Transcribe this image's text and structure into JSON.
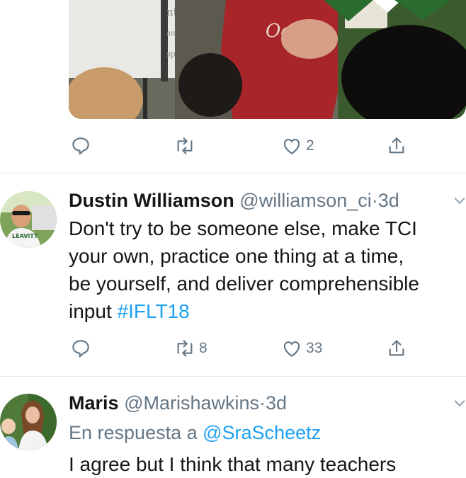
{
  "tweet1": {
    "media_alt_words": [
      "ntes",
      "ante/escritas",
      "spués"
    ],
    "actions": {
      "reply_count": "",
      "retweet_count": "",
      "like_count": "2"
    }
  },
  "tweet2": {
    "name": "Dustin Williamson",
    "handle": "@williamson_ci",
    "dot": "·",
    "time": "3d",
    "lines": [
      "Don't try to be someone else, make TCI",
      "your own, practice one thing at a time,",
      "be yourself, and deliver comprehensible"
    ],
    "last_line_prefix": "input ",
    "hashtag": "#IFLT18",
    "actions": {
      "reply_count": "",
      "retweet_count": "8",
      "like_count": "33"
    }
  },
  "tweet3": {
    "name": "Maris",
    "handle": "@Marishawkins",
    "dot": "·",
    "time": "3d",
    "reply_prefix": "En respuesta a ",
    "reply_to": "@SraScheetz",
    "partial_line": "I agree but I think that many teachers"
  },
  "icons": [
    "reply-icon",
    "retweet-icon",
    "like-icon",
    "share-icon",
    "chevron-down-icon"
  ],
  "colors": {
    "link": "#1da1f2",
    "muted": "#657786",
    "divider": "#e1e8ed"
  }
}
